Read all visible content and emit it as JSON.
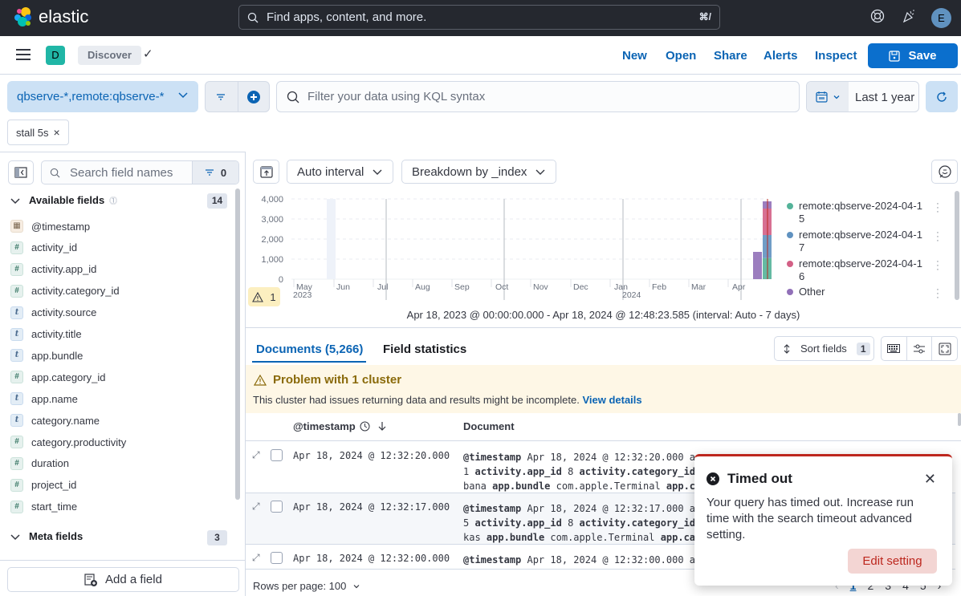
{
  "header": {
    "brand": "elastic",
    "search_placeholder": "Find apps, content, and more.",
    "search_shortcut": "⌘/",
    "help_icon": "lifebuoy-icon",
    "news_icon": "party-popper-icon",
    "user_initial": "E"
  },
  "appbar": {
    "space_initial": "D",
    "breadcrumb": "Discover",
    "links": [
      "New",
      "Open",
      "Share",
      "Alerts",
      "Inspect"
    ],
    "save_label": "Save"
  },
  "querybar": {
    "data_view": "qbserve-*,remote:qbserve-*",
    "kql_placeholder": "Filter your data using KQL syntax",
    "kql_value": "",
    "date_range": "Last 1 year",
    "filter_pill": "stall 5s"
  },
  "sidebar": {
    "search_placeholder": "Search field names",
    "filter_count": "0",
    "available_title": "Available fields",
    "available_count": "14",
    "fields": [
      {
        "name": "@timestamp",
        "type": "date"
      },
      {
        "name": "activity_id",
        "type": "number"
      },
      {
        "name": "activity.app_id",
        "type": "number"
      },
      {
        "name": "activity.category_id",
        "type": "number"
      },
      {
        "name": "activity.source",
        "type": "string"
      },
      {
        "name": "activity.title",
        "type": "string"
      },
      {
        "name": "app.bundle",
        "type": "string"
      },
      {
        "name": "app.category_id",
        "type": "number"
      },
      {
        "name": "app.name",
        "type": "string"
      },
      {
        "name": "category.name",
        "type": "string"
      },
      {
        "name": "category.productivity",
        "type": "number"
      },
      {
        "name": "duration",
        "type": "number"
      },
      {
        "name": "project_id",
        "type": "number"
      },
      {
        "name": "start_time",
        "type": "number"
      }
    ],
    "meta_title": "Meta fields",
    "meta_count": "3",
    "add_field_label": "Add a field"
  },
  "chart_toolbar": {
    "interval_label": "Auto interval",
    "breakdown_label": "Breakdown by _index",
    "warning_count": "1"
  },
  "chart_data": {
    "type": "bar",
    "stacked": true,
    "title": "",
    "xlabel": "",
    "ylabel": "",
    "ylim": [
      0,
      4000
    ],
    "y_ticks": [
      "0",
      "1,000",
      "2,000",
      "3,000",
      "4,000"
    ],
    "x_ticks": [
      {
        "label": "May",
        "sub": "2023"
      },
      {
        "label": "Jun",
        "sub": ""
      },
      {
        "label": "Jul",
        "sub": ""
      },
      {
        "label": "Aug",
        "sub": ""
      },
      {
        "label": "Sep",
        "sub": ""
      },
      {
        "label": "Oct",
        "sub": ""
      },
      {
        "label": "Nov",
        "sub": ""
      },
      {
        "label": "Dec",
        "sub": ""
      },
      {
        "label": "Jan",
        "sub": "2024"
      },
      {
        "label": "Feb",
        "sub": ""
      },
      {
        "label": "Mar",
        "sub": ""
      },
      {
        "label": "Apr",
        "sub": ""
      }
    ],
    "grid": true,
    "legend_position": "right",
    "categories": [
      "Apr 8, 2024",
      "Apr 15, 2024"
    ],
    "series": [
      {
        "name": "remote:qbserve-2024-04-15",
        "color": "#54b399",
        "values": [
          0,
          1050
        ]
      },
      {
        "name": "remote:qbserve-2024-04-17",
        "color": "#6092c0",
        "values": [
          0,
          1150
        ]
      },
      {
        "name": "remote:qbserve-2024-04-16",
        "color": "#d36086",
        "values": [
          0,
          1320
        ]
      },
      {
        "name": "Other",
        "color": "#9170b8",
        "values": [
          1360,
          360
        ]
      }
    ],
    "time_range_label": "Apr 18, 2023 @ 00:00:00.000 - Apr 18, 2024 @ 12:48:23.585 (interval: Auto - 7 days)"
  },
  "legend": [
    {
      "label": "remote:qbserve-2024-04-15",
      "color": "#54b399"
    },
    {
      "label": "remote:qbserve-2024-04-17",
      "color": "#6092c0"
    },
    {
      "label": "remote:qbserve-2024-04-16",
      "color": "#d36086"
    },
    {
      "label": "Other",
      "color": "#9170b8"
    }
  ],
  "tabs": {
    "documents": "Documents (5,266)",
    "field_statistics": "Field statistics"
  },
  "grid_toolbar": {
    "sort_fields_label": "Sort fields",
    "sort_fields_count": "1"
  },
  "callout": {
    "title": "Problem with 1 cluster",
    "body": "This cluster had issues returning data and results might be incomplete.",
    "link": "View details"
  },
  "grid": {
    "columns": [
      "@timestamp",
      "Document"
    ],
    "rows": [
      {
        "timestamp": "Apr 18, 2024 @ 12:32:20.000",
        "doc_line1_key": "@timestamp",
        "doc_line1_val": "Apr 18, 2024 @ 12:32:20.000",
        "doc_line2_pre": "1",
        "doc_line2_key1": "activity.app_id",
        "doc_line2_val1": "8",
        "doc_line2_key2": "activity.category_id",
        "doc_line3_pre": "bana",
        "doc_line3_key1": "app.bundle",
        "doc_line3_val1": "com.apple.Terminal",
        "doc_line3_key2": "app.ca"
      },
      {
        "timestamp": "Apr 18, 2024 @ 12:32:17.000",
        "doc_line1_key": "@timestamp",
        "doc_line1_val": "Apr 18, 2024 @ 12:32:17.000",
        "doc_line2_pre": "5",
        "doc_line2_key1": "activity.app_id",
        "doc_line2_val1": "8",
        "doc_line2_key2": "activity.category_id",
        "doc_line3_pre": "kas",
        "doc_line3_key1": "app.bundle",
        "doc_line3_val1": "com.apple.Terminal",
        "doc_line3_key2": "app.ca"
      },
      {
        "timestamp": "Apr 18, 2024 @ 12:32:00.000",
        "doc_line1_key": "@timestamp",
        "doc_line1_val": "Apr 18, 2024 @ 12:32:00.000"
      }
    ],
    "rows_per_page": "Rows per page: 100",
    "pages": [
      "1",
      "2",
      "3",
      "4",
      "5"
    ],
    "current_page": "1"
  },
  "toast": {
    "title": "Timed out",
    "body": "Your query has timed out. Increase run time with the search timeout advanced setting.",
    "button": "Edit setting"
  }
}
